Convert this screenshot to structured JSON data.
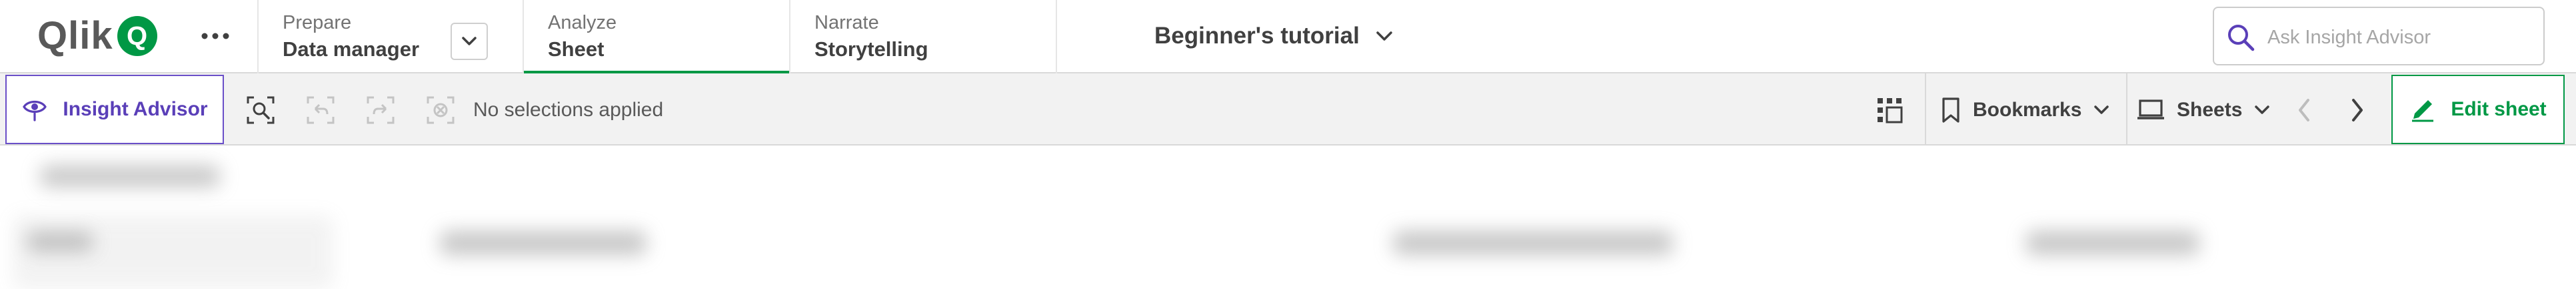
{
  "brand": {
    "logo_text": "Qlik",
    "logo_mark": "Q",
    "accent": "#009845",
    "insight_color": "#5a3fb8"
  },
  "nav": {
    "tabs": [
      {
        "small": "Prepare",
        "big": "Data manager"
      },
      {
        "small": "Analyze",
        "big": "Sheet",
        "active": true
      },
      {
        "small": "Narrate",
        "big": "Storytelling"
      }
    ]
  },
  "app_title": "Beginner's tutorial",
  "search": {
    "placeholder": "Ask Insight Advisor"
  },
  "toolbar": {
    "insight_advisor": "Insight Advisor",
    "selection_status": "No selections applied",
    "bookmarks": "Bookmarks",
    "sheets": "Sheets",
    "edit_sheet": "Edit sheet"
  },
  "icons": {
    "more": "more-horizontal-icon",
    "search": "search-icon",
    "insight": "eye-icon",
    "smart_search": "smart-search-icon",
    "step_back": "step-back-icon",
    "step_forward": "step-forward-icon",
    "clear": "clear-selections-icon",
    "grid": "grid-icon",
    "bookmark": "bookmark-icon",
    "sheets": "sheets-icon",
    "prev": "chevron-left-icon",
    "next": "chevron-right-icon",
    "edit": "pencil-icon"
  }
}
